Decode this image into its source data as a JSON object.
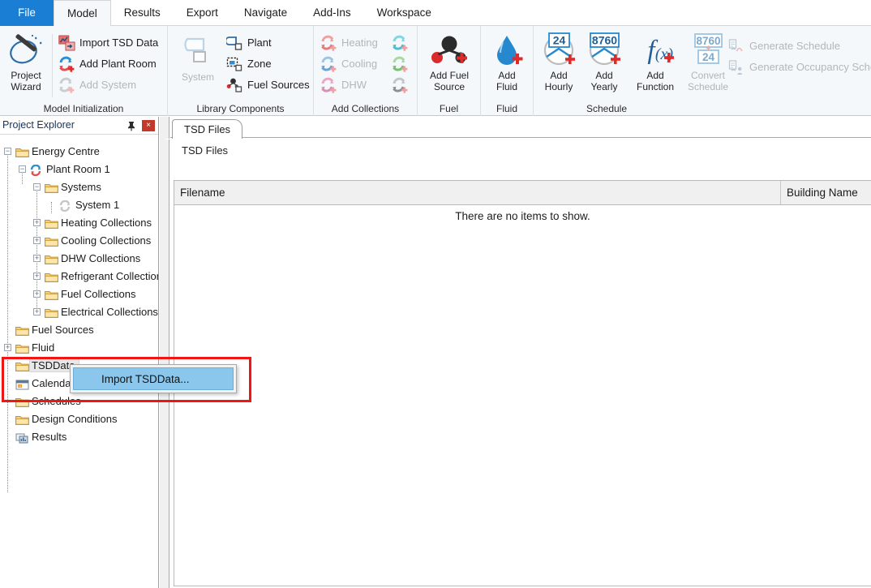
{
  "ribbon": {
    "tabs": [
      {
        "label": "File",
        "active": false,
        "accent": "#1a7fd4"
      },
      {
        "label": "Model",
        "active": true
      },
      {
        "label": "Results",
        "active": false
      },
      {
        "label": "Export",
        "active": false
      },
      {
        "label": "Navigate",
        "active": false
      },
      {
        "label": "Add-Ins",
        "active": false
      },
      {
        "label": "Workspace",
        "active": false
      }
    ],
    "groups": [
      {
        "name": "Model Initialization",
        "label": "Model Initialization",
        "big": [
          {
            "label_line1": "Project",
            "label_line2": "Wizard",
            "icon": "wizard-wand-icon",
            "disabled": false
          }
        ],
        "small": [
          {
            "label": "Import TSD Data",
            "icon": "import-tsd-icon",
            "disabled": false
          },
          {
            "label": "Add Plant Room",
            "icon": "add-plant-room-icon",
            "disabled": false
          },
          {
            "label": "Add System",
            "icon": "add-system-icon",
            "disabled": true
          }
        ]
      },
      {
        "name": "Library Components",
        "label": "Library Components",
        "big": [
          {
            "label_line1": "System",
            "label_line2": "",
            "icon": "system-icon",
            "disabled": true
          }
        ],
        "small": [
          {
            "label": "Plant",
            "icon": "plant-icon",
            "disabled": false
          },
          {
            "label": "Zone",
            "icon": "zone-icon",
            "disabled": false
          },
          {
            "label": "Fuel Sources",
            "icon": "fuel-sources-icon",
            "disabled": false
          }
        ]
      },
      {
        "name": "Add Collections",
        "label": "Add Collections",
        "small": [
          {
            "label": "Heating",
            "icon": "add-heating-icon",
            "disabled": true
          },
          {
            "label": "Cooling",
            "icon": "add-cooling-icon",
            "disabled": true
          },
          {
            "label": "DHW",
            "icon": "add-dhw-icon",
            "disabled": true
          }
        ],
        "small2": [
          {
            "label": "",
            "icon": "add-refrigerant-icon",
            "disabled": true
          },
          {
            "label": "",
            "icon": "add-fuel-collection-icon",
            "disabled": true
          },
          {
            "label": "",
            "icon": "add-electrical-collection-icon",
            "disabled": true
          }
        ]
      },
      {
        "name": "Fuel",
        "label": "Fuel",
        "big": [
          {
            "label_line1": "Add Fuel",
            "label_line2": "Source",
            "icon": "fuel-molecule-icon",
            "disabled": false
          }
        ]
      },
      {
        "name": "Fluid",
        "label": "Fluid",
        "big": [
          {
            "label_line1": "Add",
            "label_line2": "Fluid",
            "icon": "water-droplet-icon",
            "disabled": false
          }
        ]
      },
      {
        "name": "Schedule",
        "label": "Schedule",
        "big": [
          {
            "label_line1": "Add",
            "label_line2": "Hourly",
            "icon": "clock-24-icon",
            "badge": "24",
            "disabled": false
          },
          {
            "label_line1": "Add",
            "label_line2": "Yearly",
            "icon": "clock-8760-icon",
            "badge": "8760",
            "disabled": false
          },
          {
            "label_line1": "Add",
            "label_line2": "Function",
            "icon": "function-fx-icon",
            "disabled": false
          },
          {
            "label_line1": "Convert",
            "label_line2": "Schedule",
            "icon": "convert-schedule-icon",
            "badge_top": "8760",
            "badge_bottom": "24",
            "disabled": true
          }
        ],
        "small": [
          {
            "label": "Generate Schedule",
            "icon": "generate-schedule-icon",
            "disabled": true
          },
          {
            "label": "Generate Occupancy Schedule",
            "icon": "generate-occupancy-schedule-icon",
            "disabled": true
          }
        ]
      }
    ]
  },
  "explorer": {
    "title": "Project Explorer",
    "pin_icon": "pin-icon",
    "close_icon": "close-icon",
    "close_glyph": "×",
    "tree": [
      {
        "label": "Energy Centre",
        "depth": 0,
        "expander": "minus",
        "icon": "folder-icon",
        "selected": false
      },
      {
        "label": "Plant Room 1",
        "depth": 1,
        "expander": "minus",
        "icon": "plant-room-icon",
        "selected": false
      },
      {
        "label": "Systems",
        "depth": 2,
        "expander": "minus",
        "icon": "folder-icon",
        "selected": false
      },
      {
        "label": "System 1",
        "depth": 3,
        "expander": "none",
        "icon": "system-node-icon",
        "selected": false
      },
      {
        "label": "Heating Collections",
        "depth": 2,
        "expander": "plus",
        "icon": "folder-icon",
        "selected": false
      },
      {
        "label": "Cooling Collections",
        "depth": 2,
        "expander": "plus",
        "icon": "folder-icon",
        "selected": false
      },
      {
        "label": "DHW Collections",
        "depth": 2,
        "expander": "plus",
        "icon": "folder-icon",
        "selected": false
      },
      {
        "label": "Refrigerant Collections",
        "depth": 2,
        "expander": "plus",
        "icon": "folder-icon",
        "selected": false
      },
      {
        "label": "Fuel Collections",
        "depth": 2,
        "expander": "plus",
        "icon": "folder-icon",
        "selected": false
      },
      {
        "label": "Electrical Collections",
        "depth": 2,
        "expander": "plus",
        "icon": "folder-icon",
        "selected": false
      },
      {
        "label": "Fuel Sources",
        "depth": 0.7,
        "expander": "none",
        "icon": "folder-icon",
        "selected": false
      },
      {
        "label": "Fluid",
        "depth": 0.7,
        "expander": "plus",
        "icon": "folder-icon",
        "selected": false
      },
      {
        "label": "TSDData",
        "depth": 0.7,
        "expander": "none",
        "icon": "folder-icon",
        "selected": true
      },
      {
        "label": "Calendars",
        "depth": 0.7,
        "expander": "none",
        "icon": "calendar-icon",
        "selected": false
      },
      {
        "label": "Schedules",
        "depth": 0.7,
        "expander": "none",
        "icon": "folder-icon",
        "selected": false
      },
      {
        "label": "Design Conditions",
        "depth": 0.7,
        "expander": "none",
        "icon": "folder-icon",
        "selected": false
      },
      {
        "label": "Results",
        "depth": 0.7,
        "expander": "none",
        "icon": "results-icon",
        "selected": false
      }
    ]
  },
  "context_menu": {
    "items": [
      {
        "label": "Import TSDData...",
        "highlighted": true
      }
    ]
  },
  "document": {
    "tab_label": "TSD Files",
    "panel_caption": "TSD Files",
    "grid": {
      "columns": [
        "Filename",
        "Building Name"
      ],
      "rows": [],
      "empty_message": "There are no items to show."
    }
  },
  "colors": {
    "accent_blue": "#1a7fd4",
    "highlight_red": "#f31414",
    "menu_highlight": "#8bc7ed",
    "folder_yellow": "#f5c65a"
  }
}
